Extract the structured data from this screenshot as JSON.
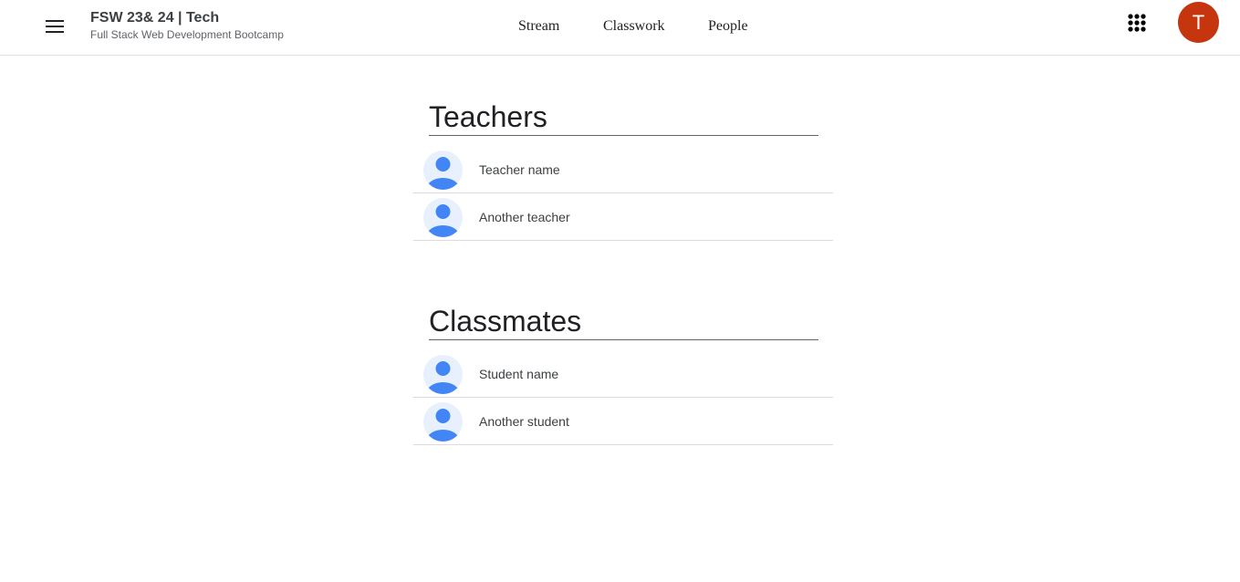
{
  "header": {
    "menu_icon": "hamburger-menu-icon",
    "class_title": "FSW 23& 24 | Tech",
    "class_subtitle": "Full Stack Web Development Bootcamp",
    "tabs": [
      {
        "label": "Stream"
      },
      {
        "label": "Classwork"
      },
      {
        "label": "People"
      }
    ],
    "apps_icon": "apps-grid-icon",
    "account_initial": "T",
    "account_color": "#c5360f"
  },
  "teachers": {
    "heading": "Teachers",
    "people": [
      {
        "name": "Teacher name",
        "icon": "default-avatar-icon"
      },
      {
        "name": "Another teacher",
        "icon": "default-avatar-icon"
      }
    ]
  },
  "classmates": {
    "heading": "Classmates",
    "people": [
      {
        "name": "Student name",
        "icon": "default-avatar-icon"
      },
      {
        "name": "Another student",
        "icon": "default-avatar-icon"
      }
    ]
  },
  "colors": {
    "avatar_bg": "#e8f0fe",
    "avatar_fg": "#4285f4"
  }
}
